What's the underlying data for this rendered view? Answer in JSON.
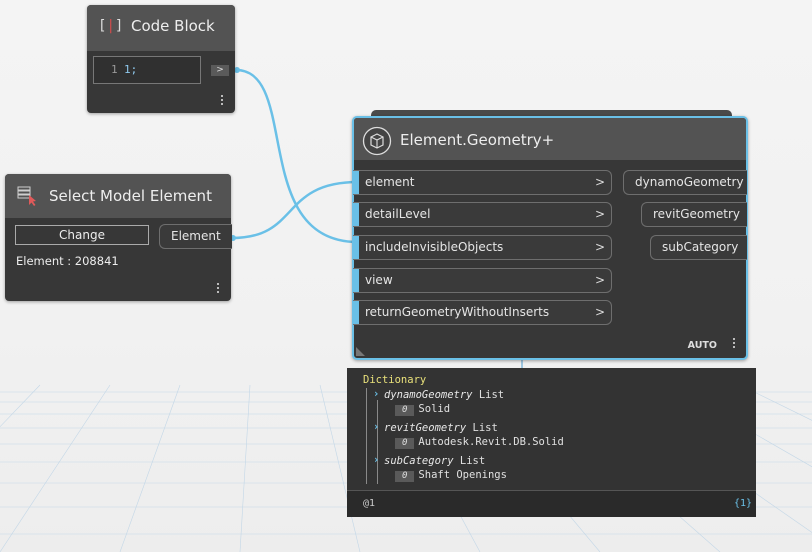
{
  "code_block": {
    "title": "Code Block",
    "line_number": "1",
    "code": "1;",
    "output_label": ">"
  },
  "select_model": {
    "title": "Select Model Element",
    "change_button": "Change",
    "element_info": "Element : 208841",
    "output_port": "Element"
  },
  "geometry_node": {
    "title": "Element.Geometry+",
    "inputs": [
      "element",
      "detailLevel",
      "includeInvisibleObjects",
      "view",
      "returnGeometryWithoutInserts"
    ],
    "outputs": [
      "dynamoGeometry",
      "revitGeometry",
      "subCategory"
    ],
    "input_chevron": ">",
    "lacing": "AUTO"
  },
  "watch": {
    "type": "Dictionary",
    "entries": [
      {
        "key": "dynamoGeometry",
        "kind": "List",
        "index": "0",
        "value": "Solid"
      },
      {
        "key": "revitGeometry",
        "kind": "List",
        "index": "0",
        "value": "Autodesk.Revit.DB.Solid"
      },
      {
        "key": "subCategory",
        "kind": "List",
        "index": "0",
        "value": "Shaft Openings"
      }
    ],
    "level": "@1",
    "count": "{1}"
  },
  "colors": {
    "wire": "#6ac0e7",
    "node_body": "#373737",
    "node_header": "#535353",
    "dictionary_label": "#e8e07a"
  },
  "icons": {
    "code_block": "code-brackets-icon",
    "select_model": "select-element-icon",
    "geometry": "geometry-cube-icon",
    "expand": "chevron-right-icon"
  }
}
